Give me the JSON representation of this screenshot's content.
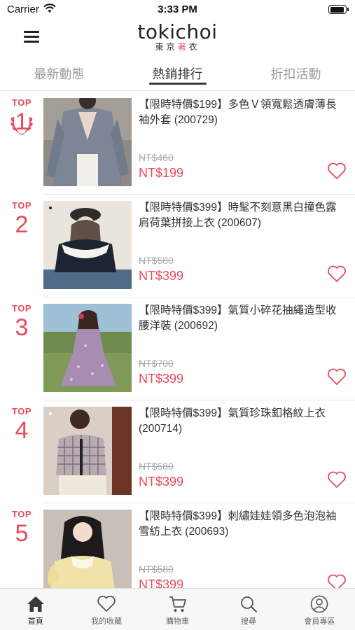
{
  "status_bar": {
    "carrier": "Carrier",
    "time": "3:33 PM",
    "battery_level": 0.95
  },
  "header": {
    "logo_text": "tokichoi",
    "logo_sub_1": "東京",
    "logo_sub_2": "著",
    "logo_sub_3": "衣"
  },
  "tabs": [
    {
      "label": "最新動態",
      "active": false
    },
    {
      "label": "熱銷排行",
      "active": true
    },
    {
      "label": "折扣活動",
      "active": false
    }
  ],
  "products": [
    {
      "rank_label": "TOP",
      "rank": "1",
      "title": "【限時特價$199】多色Ｖ領寬鬆透膚薄長袖外套 (200729)",
      "original_price": "NT$460",
      "price": "NT$199"
    },
    {
      "rank_label": "TOP",
      "rank": "2",
      "title": "【限時特價$399】時髦不刻意黑白撞色露肩荷葉拼接上衣 (200607)",
      "original_price": "NT$580",
      "price": "NT$399"
    },
    {
      "rank_label": "TOP",
      "rank": "3",
      "title": "【限時特價$399】氣質小碎花抽繩造型收腰洋裝 (200692)",
      "original_price": "NT$700",
      "price": "NT$399"
    },
    {
      "rank_label": "TOP",
      "rank": "4",
      "title": "【限時特價$399】氣質珍珠釦格紋上衣 (200714)",
      "original_price": "NT$580",
      "price": "NT$399"
    },
    {
      "rank_label": "TOP",
      "rank": "5",
      "title": "【限時特價$399】刺繡娃娃領多色泡泡袖雪紡上衣 (200693)",
      "original_price": "NT$580",
      "price": "NT$399"
    }
  ],
  "bottom_nav": [
    {
      "label": "首頁",
      "icon": "home-icon",
      "active": true
    },
    {
      "label": "我的收藏",
      "icon": "heart-icon",
      "active": false
    },
    {
      "label": "購物車",
      "icon": "cart-icon",
      "active": false
    },
    {
      "label": "搜尋",
      "icon": "search-icon",
      "active": false
    },
    {
      "label": "會員專區",
      "icon": "user-icon",
      "active": false
    }
  ],
  "colors": {
    "accent": "#e94a5e",
    "text": "#333333",
    "muted": "#9a9a9a",
    "divider": "#e6e6e6"
  }
}
